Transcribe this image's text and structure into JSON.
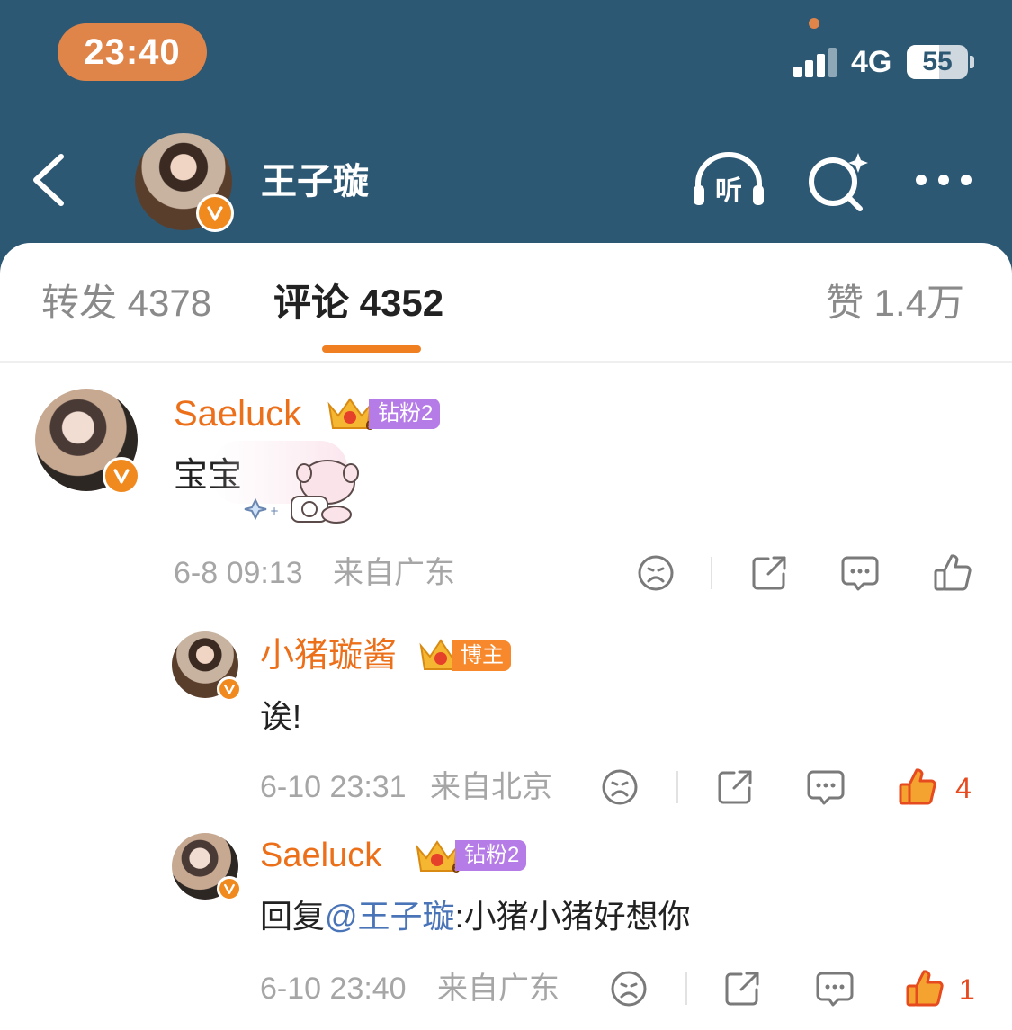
{
  "status_bar": {
    "time": "23:40",
    "network": "4G",
    "battery": "55"
  },
  "header": {
    "title": "王子璇",
    "listen_label": "听",
    "colors": {
      "background": "#2d5873",
      "accent": "#f07f22"
    }
  },
  "tabs": {
    "repost": "转发 4378",
    "comments": "评论 4352",
    "likes": "赞 1.4万"
  },
  "comments": [
    {
      "username": "Saeluck",
      "crown_level": "6",
      "tag": "钻粉2",
      "text": "宝宝",
      "time": "6-8 09:13",
      "location": "来自广东",
      "likes": ""
    },
    {
      "username": "小猪璇酱",
      "crown_level": "7",
      "tag": "博主",
      "text": "诶!",
      "time": "6-10 23:31",
      "location": "来自北京",
      "likes": "4"
    },
    {
      "username": "Saeluck",
      "crown_level": "6",
      "tag": "钻粉2",
      "text_prefix": "回复",
      "mention": "@王子璇",
      "text": ":小猪小猪好想你",
      "time": "6-10 23:40",
      "location": "来自广东",
      "likes": "1"
    }
  ]
}
